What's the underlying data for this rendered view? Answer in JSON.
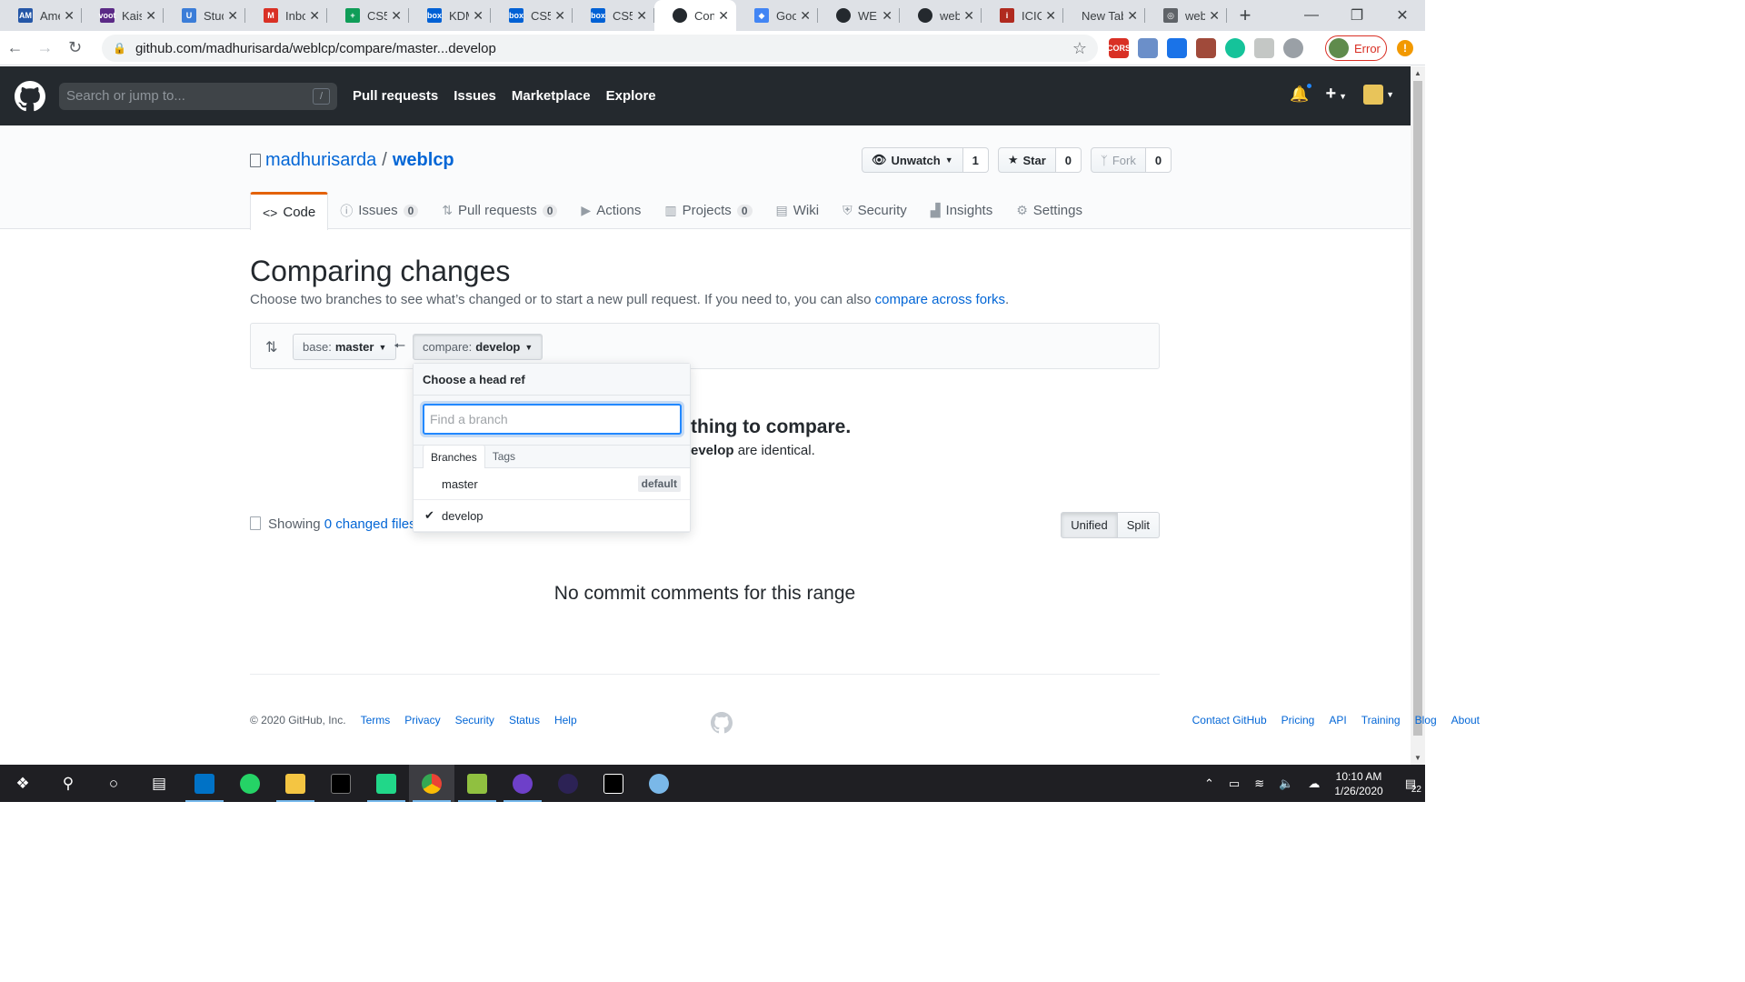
{
  "browser": {
    "tabs": [
      {
        "title": "Ame",
        "color": "#2557a7",
        "glyph": "AM"
      },
      {
        "title": "Kais",
        "color": "#5b2a86",
        "glyph": "voot"
      },
      {
        "title": "Stud",
        "color": "#3b7dd8",
        "glyph": "U"
      },
      {
        "title": "Inbo",
        "color": "#d93025",
        "glyph": "M"
      },
      {
        "title": "CS5!",
        "color": "#0f9d58",
        "glyph": "+"
      },
      {
        "title": "KDM",
        "color": "#0061d5",
        "glyph": "box"
      },
      {
        "title": "CS5!",
        "color": "#0061d5",
        "glyph": "box"
      },
      {
        "title": "CS5!",
        "color": "#0061d5",
        "glyph": "box"
      },
      {
        "title": "Con",
        "color": "#24292e",
        "glyph": "",
        "active": true
      },
      {
        "title": "Goo",
        "color": "#4285f4",
        "glyph": "◆"
      },
      {
        "title": "WEB",
        "color": "#24292e",
        "glyph": ""
      },
      {
        "title": "web",
        "color": "#24292e",
        "glyph": ""
      },
      {
        "title": "ICIC",
        "color": "#b02a1f",
        "glyph": "i"
      },
      {
        "title": "New Tab",
        "color": "",
        "glyph": ""
      },
      {
        "title": "web",
        "color": "#5f6368",
        "glyph": "◎"
      }
    ],
    "url": "github.com/madhurisarda/weblcp/compare/master...develop",
    "profile_status": "Error",
    "extension_badge": "CORS"
  },
  "github": {
    "search_placeholder": "Search or jump to...",
    "search_key": "/",
    "nav": [
      "Pull requests",
      "Issues",
      "Marketplace",
      "Explore"
    ]
  },
  "repo": {
    "owner": "madhurisarda",
    "name": "weblcp",
    "separator": "/",
    "watch_label": "Unwatch",
    "watch_count": "1",
    "star_label": "Star",
    "star_count": "0",
    "fork_label": "Fork",
    "fork_count": "0",
    "tabs": [
      {
        "label": "Code",
        "icon": "<>",
        "counter": "",
        "selected": true
      },
      {
        "label": "Issues",
        "icon": "ⓘ",
        "counter": "0"
      },
      {
        "label": "Pull requests",
        "icon": "⇅",
        "counter": "0"
      },
      {
        "label": "Actions",
        "icon": "▶",
        "counter": ""
      },
      {
        "label": "Projects",
        "icon": "▥",
        "counter": "0"
      },
      {
        "label": "Wiki",
        "icon": "▤",
        "counter": ""
      },
      {
        "label": "Security",
        "icon": "⛨",
        "counter": ""
      },
      {
        "label": "Insights",
        "icon": "▟",
        "counter": ""
      },
      {
        "label": "Settings",
        "icon": "⚙",
        "counter": ""
      }
    ]
  },
  "compare": {
    "title": "Comparing changes",
    "description": "Choose two branches to see what’s changed or to start a new pull request. If you need to, you can also",
    "forks_link": "compare across forks",
    "period": ".",
    "base_prefix": "base:",
    "base_branch": "master",
    "compare_prefix": "compare:",
    "compare_branch": "develop",
    "blank_title": "thing to compare.",
    "blank_desc_bold": "evelop",
    "blank_desc_rest": " are identical.",
    "showing_prefix": "Showing",
    "changed_files": "0 changed files",
    "view_unified": "Unified",
    "view_split": "Split",
    "no_comments": "No commit comments for this range"
  },
  "dropdown": {
    "header": "Choose a head ref",
    "filter_placeholder": "Find a branch",
    "tab_branches": "Branches",
    "tab_tags": "Tags",
    "items": [
      {
        "name": "master",
        "label": "default",
        "checked": false
      },
      {
        "name": "develop",
        "label": "",
        "checked": true
      }
    ]
  },
  "footer": {
    "copyright": "© 2020 GitHub, Inc.",
    "left_links": [
      "Terms",
      "Privacy",
      "Security",
      "Status",
      "Help"
    ],
    "right_links": [
      "Contact GitHub",
      "Pricing",
      "API",
      "Training",
      "Blog",
      "About"
    ]
  },
  "taskbar": {
    "time": "10:10 AM",
    "date": "1/26/2020",
    "notification_count": "22"
  }
}
